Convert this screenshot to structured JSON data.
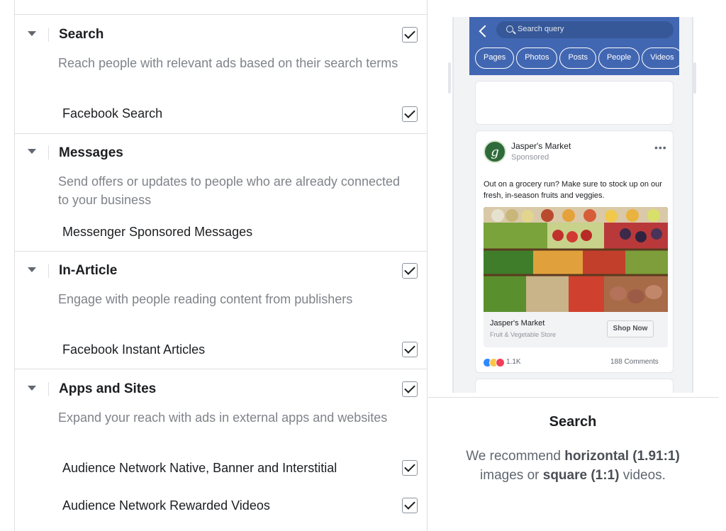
{
  "sections": [
    {
      "title": "Search",
      "description": "Reach people with relevant ads based on their search terms",
      "checked": true,
      "items": [
        {
          "label": "Facebook Search",
          "checked": true
        }
      ]
    },
    {
      "title": "Messages",
      "description": "Send offers or updates to people who are already connected to your business",
      "checked": false,
      "items": [
        {
          "label": "Messenger Sponsored Messages",
          "checked": false
        }
      ]
    },
    {
      "title": "In-Article",
      "description": "Engage with people reading content from publishers",
      "checked": true,
      "items": [
        {
          "label": "Facebook Instant Articles",
          "checked": true
        }
      ]
    },
    {
      "title": "Apps and Sites",
      "description": "Expand your reach with ads in external apps and websites",
      "checked": true,
      "items": [
        {
          "label": "Audience Network Native, Banner and Interstitial",
          "checked": true
        },
        {
          "label": "Audience Network Rewarded Videos",
          "checked": true
        }
      ]
    }
  ],
  "preview": {
    "search_placeholder": "Search query",
    "chips": [
      "Pages",
      "Photos",
      "Posts",
      "People",
      "Videos"
    ],
    "post": {
      "avatar_letter": "g",
      "advertiser": "Jasper's Market",
      "sponsored": "Sponsored",
      "more": "•••",
      "text": "Out on a grocery run? Make sure to stock up on our fresh, in-season fruits and veggies.",
      "link_title": "Jasper's Market",
      "link_subtitle": "Fruit & Vegetable Store",
      "cta": "Shop Now",
      "reaction_count": "1.1K",
      "comments": "188 Comments"
    },
    "colors": {
      "app_bar": "#4267b2",
      "search_pill": "#365899"
    }
  },
  "placement": {
    "title": "Search",
    "rec_1": "We recommend ",
    "rec_2": "horizontal (1.91:1)",
    "rec_3": " images or ",
    "rec_4": "square (1:1)",
    "rec_5": " videos."
  }
}
